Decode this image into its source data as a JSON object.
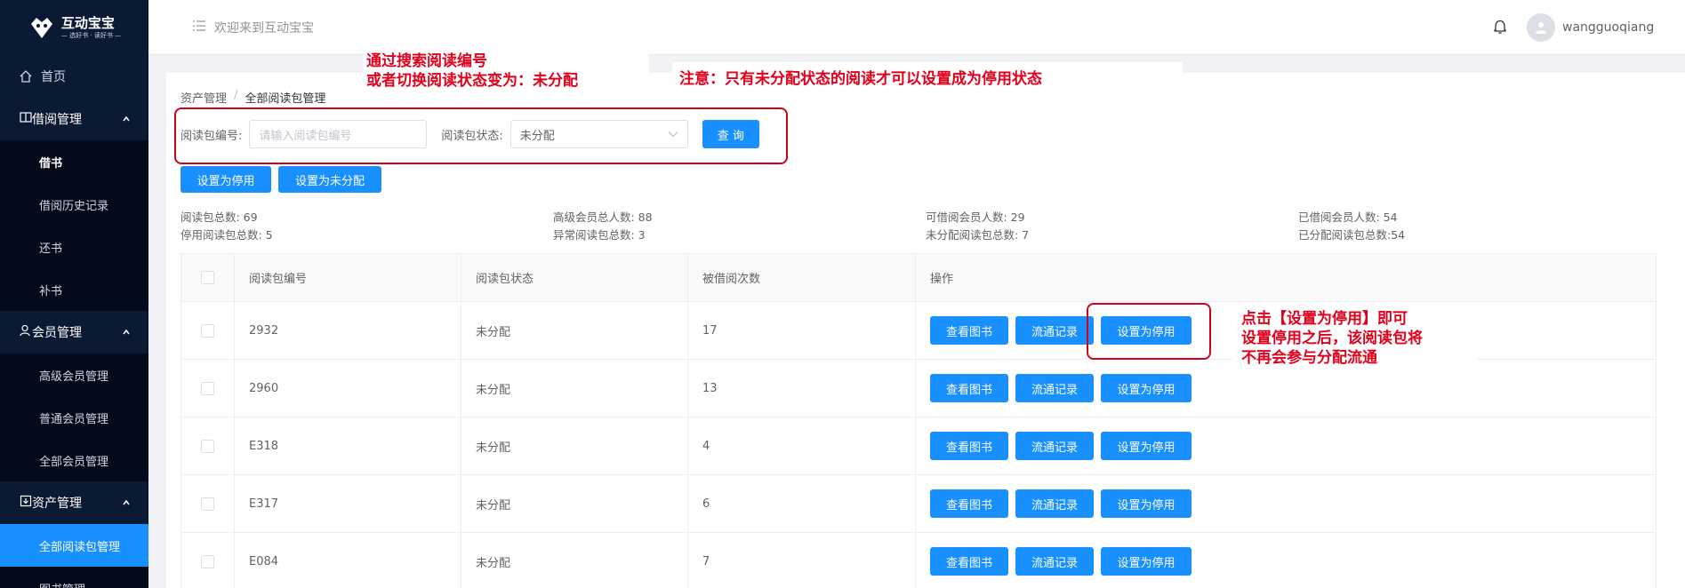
{
  "sidebar": {
    "logo_title": "互动宝宝",
    "logo_sub": "— 选好书 · 读好书 —",
    "home": "首页",
    "groups": [
      {
        "label": "借阅管理",
        "items": [
          "借书",
          "借阅历史记录",
          "还书",
          "补书"
        ]
      },
      {
        "label": "会员管理",
        "items": [
          "高级会员管理",
          "普通会员管理",
          "全部会员管理"
        ]
      },
      {
        "label": "资产管理",
        "items": [
          "全部阅读包管理",
          "图书管理"
        ]
      }
    ]
  },
  "header": {
    "welcome": "欢迎来到互动宝宝",
    "username": "wangguoqiang"
  },
  "breadcrumb": [
    "资产管理",
    "全部阅读包管理"
  ],
  "search": {
    "code_label": "阅读包编号:",
    "code_placeholder": "请输入阅读包编号",
    "status_label": "阅读包状态:",
    "status_value": "未分配",
    "query_button": "查 询"
  },
  "actions": {
    "set_disabled": "设置为停用",
    "set_unassigned": "设置为未分配"
  },
  "stats": {
    "total_packages": "阅读包总数: 69",
    "disabled_packages": "停用阅读包总数: 5",
    "premium_members": "高级会员总人数: 88",
    "abnormal_packages": "异常阅读包总数: 3",
    "borrowable_members": "可借阅会员人数: 29",
    "unassigned_packages": "未分配阅读包总数: 7",
    "borrowed_members": "已借阅会员人数: 54",
    "assigned_packages": "已分配阅读包总数:54"
  },
  "table": {
    "headers": [
      "阅读包编号",
      "阅读包状态",
      "被借阅次数",
      "操作"
    ],
    "rows": [
      {
        "code": "2932",
        "status": "未分配",
        "count": "17"
      },
      {
        "code": "2960",
        "status": "未分配",
        "count": "13"
      },
      {
        "code": "E318",
        "status": "未分配",
        "count": "4"
      },
      {
        "code": "E317",
        "status": "未分配",
        "count": "6"
      },
      {
        "code": "E084",
        "status": "未分配",
        "count": "7"
      }
    ],
    "op_view": "查看图书",
    "op_flow": "流通记录",
    "op_disable": "设置为停用"
  },
  "annotations": {
    "search_note_1": "通过搜索阅读编号",
    "search_note_2": "或者切换阅读状态变为：未分配",
    "warning": "注意：只有未分配状态的阅读才可以设置成为停用状态",
    "click_note_1": "点击【设置为停用】即可",
    "click_note_2": "设置停用之后，该阅读包将",
    "click_note_3": "不再会参与分配流通"
  },
  "colors": {
    "sidebar_bg": "#0b1a33",
    "submenu_bg": "#030b1a",
    "primary": "#1890ff",
    "annotation_red": "#e0001b"
  }
}
